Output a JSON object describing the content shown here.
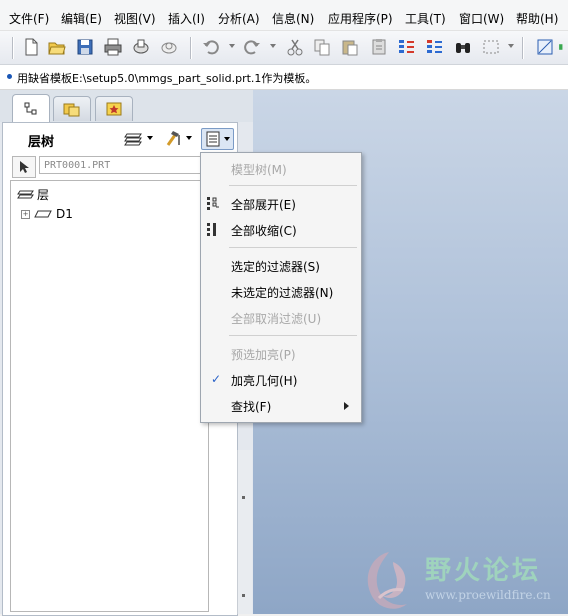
{
  "menubar": {
    "items": [
      "文件(F)",
      "编辑(E)",
      "视图(V)",
      "插入(I)",
      "分析(A)",
      "信息(N)",
      "应用程序(P)",
      "工具(T)",
      "窗口(W)",
      "帮助(H)"
    ]
  },
  "message_bar": {
    "text": "用缺省模板E:\\setup5.0\\mmgs_part_solid.prt.1作为模板。"
  },
  "navigator": {
    "title": "层树",
    "model_name_field": "PRT0001.PRT",
    "tree": {
      "root_label": "层",
      "expander": "+",
      "child_label": "D1"
    }
  },
  "context_menu": {
    "model_tree": "模型树(M)",
    "expand_all": "全部展开(E)",
    "collapse_all": "全部收缩(C)",
    "selected_filter": "选定的过滤器(S)",
    "unselected_filter": "未选定的过滤器(N)",
    "cancel_all_filters": "全部取消过滤(U)",
    "preselect_highlight": "预选加亮(P)",
    "highlight_geometry": "加亮几何(H)",
    "find": "查找(F)",
    "check_mark": "✓"
  },
  "watermark": {
    "title": "野火论坛",
    "url": "www.proewildfire.cn"
  },
  "colors": {
    "graphics_top": "#cad6e6",
    "graphics_bottom": "#8ea6c6",
    "accent": "#2a62c8",
    "disabled_text": "#a8a8a8"
  }
}
